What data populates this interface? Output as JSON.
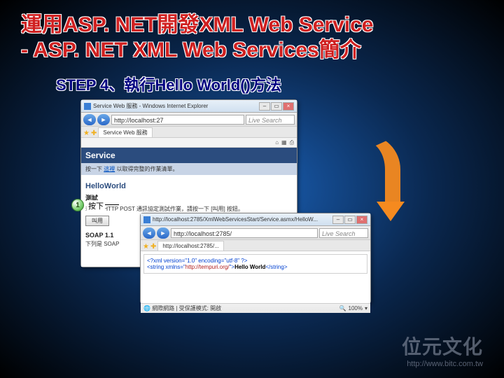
{
  "title": {
    "line1": "運用ASP. NET開發XML Web Service",
    "line2": "- ASP. NET XML Web Services簡介"
  },
  "step_heading": "STEP 4、執行Hello World()方法",
  "annotation": {
    "num": "1",
    "label": "按下"
  },
  "browser1": {
    "window_title": "Service Web 服務 - Windows Internet Explorer",
    "url": "http://localhost:27",
    "search_placeholder": "Live Search",
    "tab_label": "Service Web 服務",
    "service_header": "Service",
    "service_subtext_pre": "按一下",
    "service_subtext_link": "這裡",
    "service_subtext_post": "以取得完整的作業清單。",
    "method_name": "HelloWorld",
    "test_label": "測試",
    "test_text": "若要以 HTTP POST 通訊協定測試作業，請按一下 [叫用] 按鈕。",
    "invoke_button": "叫用",
    "soap_label": "SOAP 1.1",
    "soap_text": "下列是 SOAP"
  },
  "browser2": {
    "window_title": "http://localhost:2785/XmlWebServicesStart/Service.asmx/HelloW...",
    "url": "http://localhost:2785/",
    "search_placeholder": "Live Search",
    "tab_label": "http://localhost:2785/...",
    "xml_decl": "<?xml version=\"1.0\" encoding=\"utf-8\" ?>",
    "xml_open": "<string xmlns=\"",
    "xml_ns": "http://tempuri.org/",
    "xml_open_end": "\">",
    "xml_value": "Hello World",
    "xml_close": "</string>",
    "status_left": "網際網路 | 受保護模式: 開啟",
    "zoom": "100%"
  },
  "footer": {
    "brand": "位元文化",
    "url": "http://www.bitc.com.tw"
  }
}
